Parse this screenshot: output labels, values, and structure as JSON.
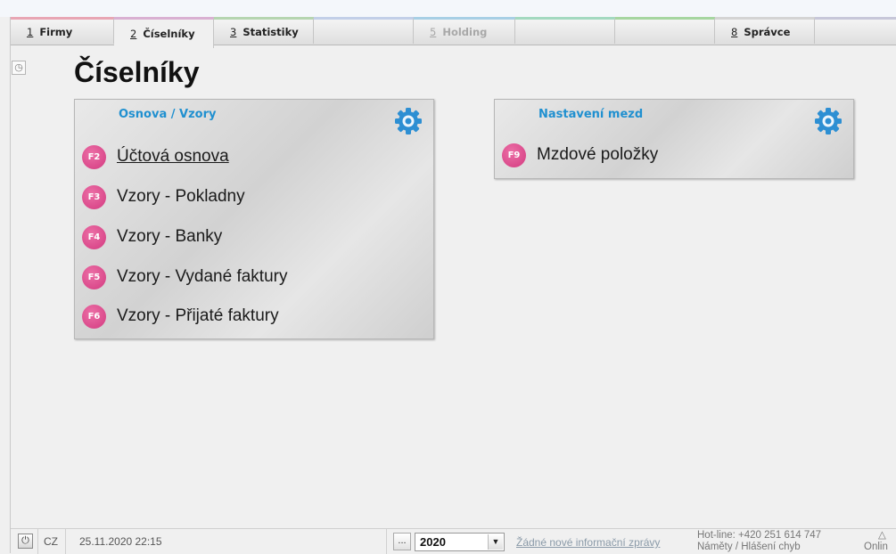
{
  "tabs": [
    {
      "num": "1",
      "label": "Firmy"
    },
    {
      "num": "2",
      "label": "Číselníky"
    },
    {
      "num": "3",
      "label": "Statistiky"
    },
    {
      "num": "5",
      "label": "Holding"
    },
    {
      "num": "8",
      "label": "Správce"
    }
  ],
  "page": {
    "title": "Číselníky"
  },
  "panels": {
    "osnova": {
      "title": "Osnova / Vzory",
      "items": [
        {
          "key": "F2",
          "label": "Účtová osnova"
        },
        {
          "key": "F3",
          "label": "Vzory - Pokladny"
        },
        {
          "key": "F4",
          "label": "Vzory - Banky"
        },
        {
          "key": "F5",
          "label": "Vzory - Vydané faktury"
        },
        {
          "key": "F6",
          "label": "Vzory - Přijaté faktury"
        }
      ]
    },
    "mzdy": {
      "title": "Nastavení mezd",
      "items": [
        {
          "key": "F9",
          "label": "Mzdové položky"
        }
      ]
    }
  },
  "status": {
    "lang": "CZ",
    "datetime": "25.11.2020 22:15",
    "ellipsis": "...",
    "year": "2020",
    "messages": "Žádné nové informační zprávy",
    "hotline": "Hot-line: +420 251 614 747",
    "feedback": "Náměty / Hlášení chyb",
    "online": "Onlin"
  },
  "colors": {
    "accent": "#2090d0",
    "badge": "#d94b8c",
    "tab_strips": [
      "#e8a6b4",
      "#d9b0d2",
      "#b5d5b0",
      "#c2cfe8",
      "#a7cfe5",
      "#a3d9c0",
      "#a6d6a0",
      "#d4d4d4",
      "#c7c7d9"
    ]
  },
  "icons": {
    "history": "history-icon",
    "gear": "gear-icon",
    "power": "power-icon",
    "dropdown": "chevron-down-icon"
  }
}
